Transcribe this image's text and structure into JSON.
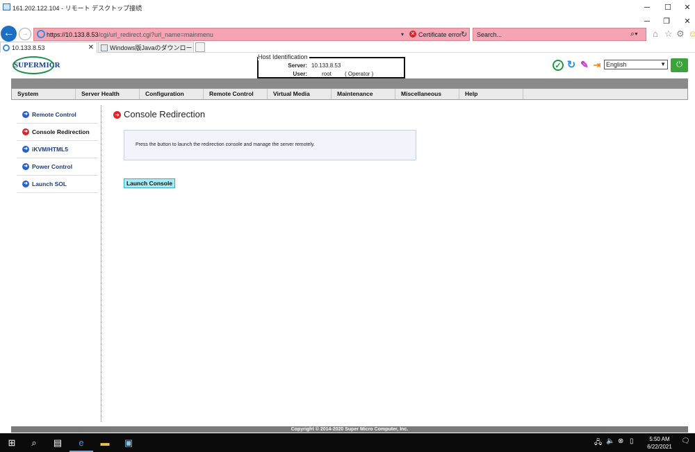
{
  "rdp": {
    "title": "161.202.122.104 - リモート デスクトップ接続",
    "minimize": "─",
    "maximize": "☐",
    "close": "✕"
  },
  "browser": {
    "url_host": "https://10.133.8.53",
    "url_path": "/cgi/url_redirect.cgi?url_name=mainmenu",
    "cert_error": "Certificate error",
    "search_placeholder": "Search...",
    "tabs": [
      {
        "label": "10.133.8.53"
      },
      {
        "label": "Windows版Javaのダウンロード"
      }
    ]
  },
  "header": {
    "logo": "SUPERMICR",
    "host_legend": "Host Identification",
    "server_label": "Server:",
    "server_value": "10.133.8.53",
    "user_label": "User:",
    "user_value": "root",
    "user_role": "( Operator )",
    "language": "English"
  },
  "nav": {
    "items": [
      "System",
      "Server Health",
      "Configuration",
      "Remote Control",
      "Virtual Media",
      "Maintenance",
      "Miscellaneous",
      "Help"
    ]
  },
  "sidebar": {
    "items": [
      {
        "label": "Remote Control",
        "active": false
      },
      {
        "label": "Console Redirection",
        "active": true
      },
      {
        "label": "iKVM/HTML5",
        "active": false
      },
      {
        "label": "Power Control",
        "active": false
      },
      {
        "label": "Launch SOL",
        "active": false
      }
    ]
  },
  "main": {
    "title": "Console Redirection",
    "description": "Press the button to launch the redirection console and manage the server remotely.",
    "launch_button": "Launch Console"
  },
  "footer": {
    "copyright": "Copyright © 2014-2020 Super Micro Computer, Inc."
  },
  "taskbar": {
    "time": "5:50 AM",
    "date": "6/22/2021"
  }
}
